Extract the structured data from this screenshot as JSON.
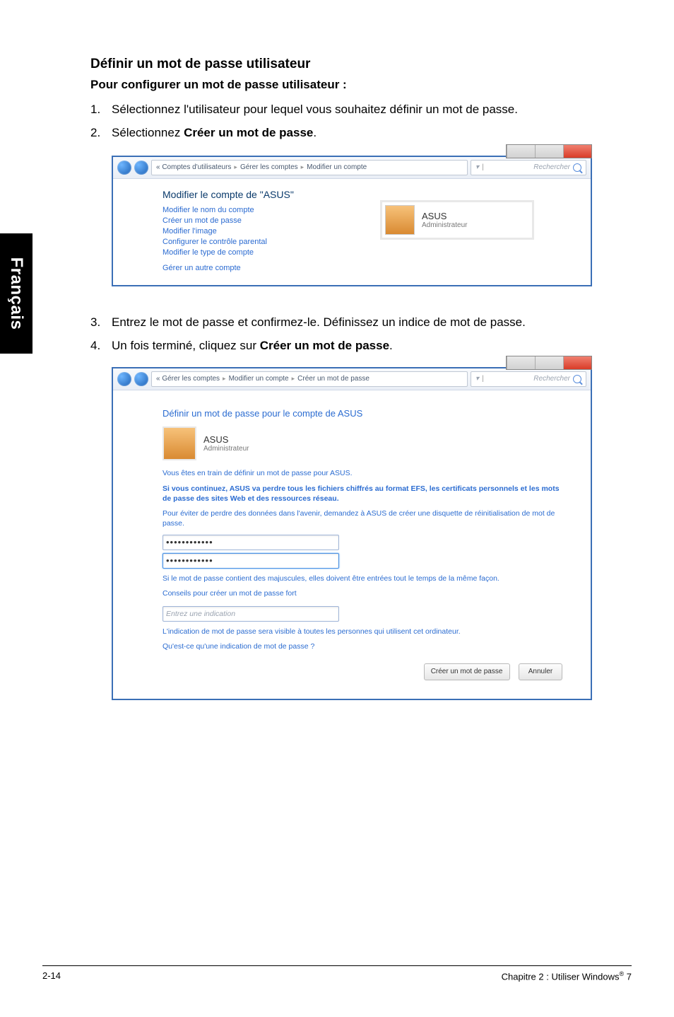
{
  "doc": {
    "heading": "Définir un mot de passe utilisateur",
    "subheading": "Pour configurer un mot de passe utilisateur :",
    "step1_num": "1.",
    "step1": "Sélectionnez l'utilisateur pour lequel vous souhaitez définir un mot de passe.",
    "step2_num": "2.",
    "step2_pre": "Sélectionnez ",
    "step2_bold": "Créer un mot de passe",
    "step2_post": ".",
    "step3_num": "3.",
    "step3": "Entrez le mot de passe et confirmez-le. Définissez un indice de mot de passe.",
    "step4_num": "4.",
    "step4_pre": "Un fois terminé, cliquez sur ",
    "step4_bold": "Créer un mot de passe",
    "step4_post": "."
  },
  "sidebar": {
    "label": "Français"
  },
  "win1": {
    "crumb_prefix": "« Comptes d'utilisateurs",
    "crumb_b": "Gérer les comptes",
    "crumb_c": "Modifier un compte",
    "search_placeholder": "Rechercher",
    "heading": "Modifier le compte de \"ASUS\"",
    "links": {
      "rename": "Modifier le nom du compte",
      "create_pw": "Créer un mot de passe",
      "change_img": "Modifier l'image",
      "parental": "Configurer le contrôle parental",
      "change_type": "Modifier le type de compte",
      "manage_other": "Gérer un autre compte"
    },
    "account": {
      "name": "ASUS",
      "role": "Administrateur"
    }
  },
  "win2": {
    "crumb_a": "« Gérer les comptes",
    "crumb_b": "Modifier un compte",
    "crumb_c": "Créer un mot de passe",
    "search_placeholder": "Rechercher",
    "heading": "Définir un mot de passe pour le compte de ASUS",
    "account_name": "ASUS",
    "account_role": "Administrateur",
    "line1": "Vous êtes en train de définir un mot de passe pour ASUS.",
    "line2": "Si vous continuez, ASUS va perdre tous les fichiers chiffrés au format EFS, les certificats personnels et les mots de passe des sites Web et des ressources réseau.",
    "line3": "Pour éviter de perdre des données dans l'avenir, demandez à ASUS de créer une disquette de réinitialisation de mot de passe.",
    "pw1": "••••••••••••",
    "pw2": "••••••••••••",
    "hint1": "Si le mot de passe contient des majuscules, elles doivent être entrées tout le temps de la même façon.",
    "hint_link1": "Conseils pour créer un mot de passe fort",
    "ind_field": "Entrez une indication",
    "ind_note": "L'indication de mot de passe sera visible à toutes les personnes qui utilisent cet ordinateur.",
    "ind_link": "Qu'est-ce qu'une indication de mot de passe ?",
    "btn_create": "Créer un mot de passe",
    "btn_cancel": "Annuler"
  },
  "footer": {
    "left": "2-14",
    "right_pre": "Chapitre 2 : Utiliser Windows",
    "right_sup": "®",
    "right_post": " 7"
  }
}
